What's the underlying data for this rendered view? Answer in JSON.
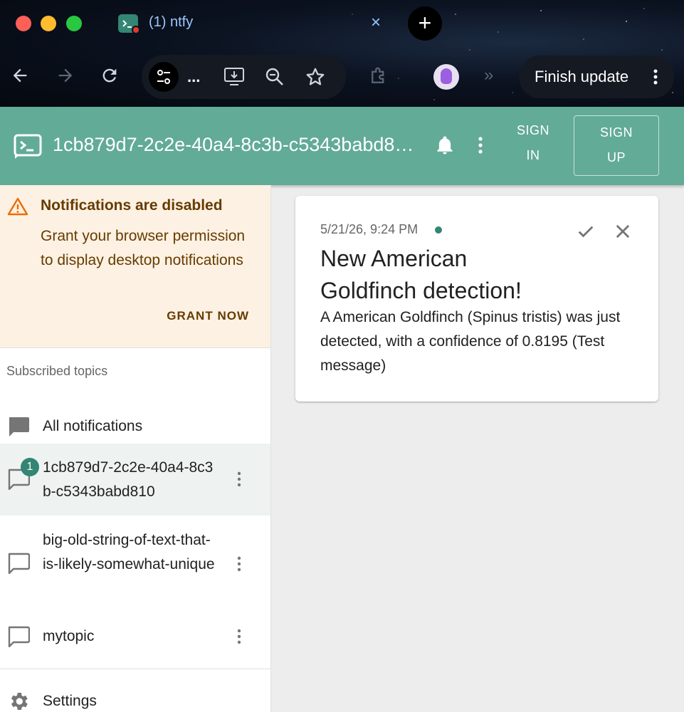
{
  "browser": {
    "tab_title": "(1) ntfy",
    "tab_close": "×",
    "new_tab": "+",
    "omnibox_ellipsis": "...",
    "finish_update_label": "Finish update"
  },
  "app": {
    "title": "1cb879d7-2c2e-40a4-8c3b-c5343babd810",
    "sign_in": [
      "SIGN",
      "IN"
    ],
    "sign_up": [
      "SIGN",
      "UP"
    ]
  },
  "alert": {
    "title": "Notifications are disabled",
    "body": "Grant your browser permission to display desktop notifications",
    "action": "GRANT NOW"
  },
  "sidebar": {
    "subheader": "Subscribed topics",
    "all_notifications": "All notifications",
    "topics": [
      {
        "name": "1cb879d7-2c2e-40a4-8c3b-c5343babd810",
        "badge": "1"
      },
      {
        "name": "big-old-string-of-text-that-is-likely-somewhat-unique"
      },
      {
        "name": "mytopic"
      }
    ],
    "settings": "Settings"
  },
  "notification": {
    "timestamp": "5/21/26, 9:24 PM",
    "title": "New American Goldfinch detection!",
    "message": "A American Goldfinch (Spinus tristis) was just detected, with a confidence of 0.8195 (Test message)"
  },
  "colors": {
    "accent": "#338574",
    "appbar": "#62ab97",
    "alert_bg": "#fdf1e3",
    "alert_text": "#663c00"
  }
}
